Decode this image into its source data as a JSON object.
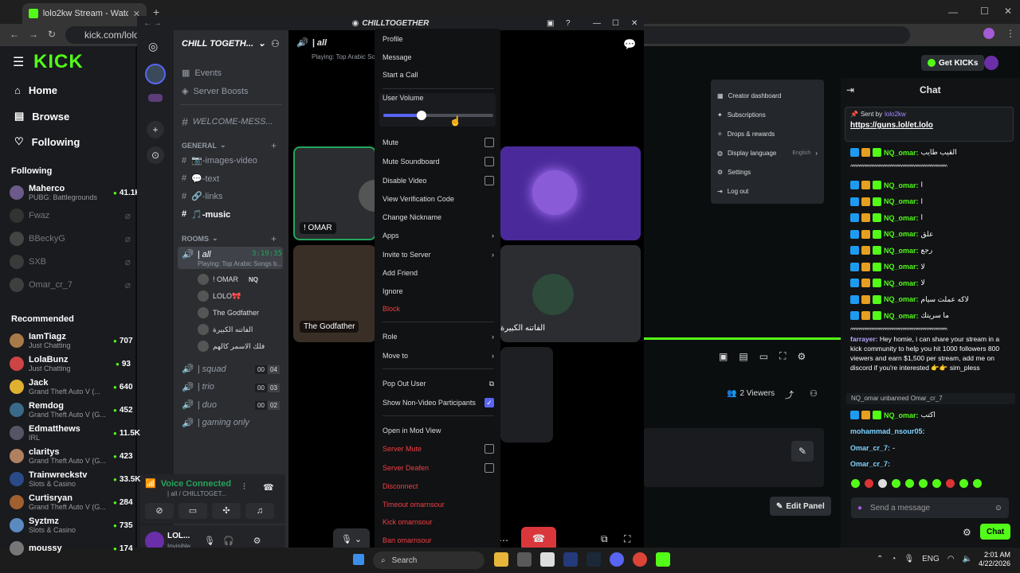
{
  "browser": {
    "tab_title": "lolo2kw Stream - Watch Live on",
    "url": "kick.com/lolo2kw"
  },
  "kick": {
    "logo": "KICK",
    "nav": [
      "Home",
      "Browse",
      "Following"
    ],
    "following_heading": "Following",
    "following": [
      {
        "name": "Maherco",
        "game": "PUBG: Battlegrounds",
        "viewers": "41.1K",
        "live": true
      },
      {
        "name": "Fwaz",
        "live": false
      },
      {
        "name": "BBeckyG",
        "live": false
      },
      {
        "name": "SXB",
        "live": false
      },
      {
        "name": "Omar_cr_7",
        "live": false
      }
    ],
    "recommended_heading": "Recommended",
    "recommended": [
      {
        "name": "IamTiagz",
        "game": "Just Chatting",
        "viewers": "707"
      },
      {
        "name": "LolaBunz",
        "game": "Just Chatting",
        "viewers": "93"
      },
      {
        "name": "Jack",
        "game": "Grand Theft Auto V (...",
        "viewers": "640"
      },
      {
        "name": "Remdog",
        "game": "Grand Theft Auto V (G...",
        "viewers": "452"
      },
      {
        "name": "Edmatthews",
        "game": "IRL",
        "viewers": "11.5K"
      },
      {
        "name": "claritys",
        "game": "Grand Theft Auto V (G...",
        "viewers": "423"
      },
      {
        "name": "Trainwreckstv",
        "game": "Slots & Casino",
        "viewers": "33.5K"
      },
      {
        "name": "Curtisryan",
        "game": "Grand Theft Auto V (G...",
        "viewers": "284"
      },
      {
        "name": "Syztmz",
        "game": "Slots & Casino",
        "viewers": "735"
      },
      {
        "name": "moussy",
        "game": "",
        "viewers": "174"
      }
    ],
    "get_kicks": "Get KICKs",
    "user_menu": [
      "Creator dashboard",
      "Subscriptions",
      "Drops & rewards",
      "Display language",
      "Settings",
      "Log out"
    ],
    "display_language_value": "English",
    "chat_title": "Chat",
    "pinned_by": "Sent by",
    "pinned_user": "lolo2kw",
    "pinned_link": "https://guns.lol/et.lolo",
    "chat_lines": [
      {
        "user": "NQ_omar:",
        "text": "القيب طايب"
      },
      {
        "user": "",
        "text": "^^^^^^^^^^^^^^^^^^^^^^^^^^^^^^^^^^^^^^^^^^^^^^^^^^^^^"
      },
      {
        "user": "NQ_omar:",
        "text": "ا"
      },
      {
        "user": "NQ_omar:",
        "text": "ا"
      },
      {
        "user": "NQ_omar:",
        "text": "ا"
      },
      {
        "user": "NQ_omar:",
        "text": "علق"
      },
      {
        "user": "NQ_omar:",
        "text": "رجع"
      },
      {
        "user": "NQ_omar:",
        "text": "لا"
      },
      {
        "user": "NQ_omar:",
        "text": "لا"
      },
      {
        "user": "NQ_omar:",
        "text": "لاكه عملت سيام"
      },
      {
        "user": "NQ_omar:",
        "text": "ما سريتك"
      },
      {
        "user": "",
        "text": "^^^^^^^^^^^^^^^^^^^^^^^^^^^^^^^^^^^^^^^^^^^^^^^^^^^^^"
      }
    ],
    "spam_user": "farrayer:",
    "spam_text": "Hey homie, i can share your stream in a kick community to help you hit 1000 followers 800 viewers and earn $1,500 per stream, add me on discord if you're interested 👉👉 sim_pless",
    "mod_notice": "NQ_omar unbanned Omar_cr_7",
    "chat_tail": [
      {
        "user": "NQ_omar:",
        "text": "اكتب"
      },
      {
        "user": "mohammad_nsour05:",
        "text": ""
      },
      {
        "user": "Omar_cr_7:",
        "text": "-"
      },
      {
        "user": "Omar_cr_7:",
        "text": ""
      }
    ],
    "viewers": "2 Viewers",
    "edit_panel": "Edit Panel",
    "send_placeholder": "Send a message",
    "chat_button": "Chat"
  },
  "discord": {
    "window_title": "CHILLTOGETHER",
    "server_name": "CHILL TOGETH...",
    "events": "Events",
    "boosts": "Server Boosts",
    "welcome": "WELCOME-MESS...",
    "general_cat": "GENERAL",
    "text_channels": [
      "📷-images-video",
      "💬-text",
      "🔗-links",
      "🎵-music"
    ],
    "rooms_cat": "ROOMS",
    "voice_all": "| all",
    "voice_all_timer": "3:19:35",
    "voice_all_status": "Playing: Top Arabic Songs b...",
    "voice_members": [
      "! OMAR",
      "LOLO🎀",
      "The Godfather",
      "الفاتنه الكبيرة",
      "فلك الاسمر كالهم"
    ],
    "omar_tag": "NQ",
    "other_voice": [
      {
        "name": "| squad",
        "a": "00",
        "b": "04"
      },
      {
        "name": "| trio",
        "a": "00",
        "b": "03"
      },
      {
        "name": "| duo",
        "a": "00",
        "b": "02"
      },
      {
        "name": "| gaming only",
        "a": "",
        "b": ""
      }
    ],
    "voice_connected": "Voice Connected",
    "voice_connected_sub": "| all / CHILLTOGET...",
    "user_name": "LOL...",
    "user_status": "Invisible",
    "header_channel": "| all",
    "header_status": "Playing: Top Arabic So...",
    "tiles": [
      "! OMAR",
      "The Godfather",
      "الفاتنه الكبيرة"
    ]
  },
  "context_menu": {
    "items_top": [
      "Profile",
      "Message",
      "Start a Call"
    ],
    "user_volume": "User Volume",
    "volume_level": 0.35,
    "toggles": [
      {
        "label": "Mute",
        "checked": false
      },
      {
        "label": "Mute Soundboard",
        "checked": false
      },
      {
        "label": "Disable Video",
        "checked": false
      }
    ],
    "mid": [
      "View Verification Code",
      "Change Nickname"
    ],
    "apps": "Apps",
    "invite": "Invite to Server",
    "add_friend": "Add Friend",
    "ignore": "Ignore",
    "block": "Block",
    "role": "Role",
    "move_to": "Move to",
    "pop_out": "Pop Out User",
    "show_non_video": "Show Non-Video Participants",
    "mod_view": "Open in Mod View",
    "server_mute": "Server Mute",
    "server_deafen": "Server Deafen",
    "disconnect": "Disconnect",
    "timeout": "Timeout omarnsour",
    "kick": "Kick omarnsour",
    "ban": "Ban omarnsour"
  },
  "taskbar": {
    "search": "Search",
    "lang": "ENG",
    "time": "2:01 AM",
    "date": "4/22/2026"
  },
  "colors": {
    "kick_green": "#53fc18",
    "discord_blurple": "#5865f2",
    "danger": "#f23f43"
  }
}
